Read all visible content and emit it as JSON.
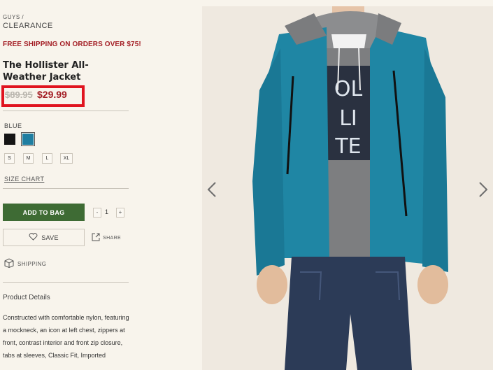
{
  "breadcrumb": {
    "parent": "GUYS",
    "separator": "/",
    "current": "CLEARANCE"
  },
  "promo": "FREE SHIPPING ON ORDERS OVER $75!",
  "product": {
    "title": "The Hollister All-Weather Jacket",
    "original_price": "$89.95",
    "sale_price": "$29.99",
    "selected_color": "BLUE",
    "colors": [
      {
        "name": "black",
        "hex": "#151515"
      },
      {
        "name": "blue",
        "hex": "#1f7ea1",
        "selected": true
      }
    ],
    "sizes": [
      "S",
      "M",
      "L",
      "XL"
    ],
    "size_chart_label": "SIZE CHART",
    "quantity": "1",
    "qty_minus": "-",
    "qty_plus": "+"
  },
  "actions": {
    "add_to_bag": "ADD TO BAG",
    "save": "SAVE",
    "share": "SHARE",
    "shipping": "SHIPPING"
  },
  "details": {
    "heading": "Product Details",
    "description": "Constructed with comfortable nylon, featuring a mockneck, an icon at left chest, zippers at front, contrast interior and front zip closure, tabs at sleeves, Classic Fit, Imported"
  },
  "colors": {
    "promo_red": "#a31d24",
    "highlight_box": "#e0141f",
    "add_bag_green": "#3e6b34",
    "page_bg": "#f8f4ec"
  },
  "icons": [
    "heart-icon",
    "share-icon",
    "box-icon",
    "chevron-left-icon",
    "chevron-right-icon"
  ]
}
